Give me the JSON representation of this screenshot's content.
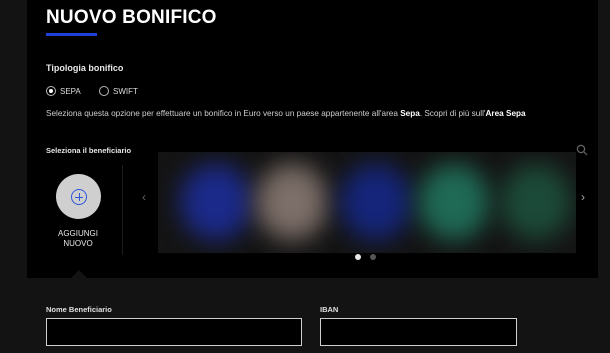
{
  "page": {
    "title": "NUOVO BONIFICO",
    "accent_color": "#1f3fd6"
  },
  "transfer_type": {
    "label": "Tipologia bonifico",
    "options": [
      {
        "label": "SEPA",
        "selected": true
      },
      {
        "label": "SWIFT",
        "selected": false
      }
    ],
    "description_prefix": "Seleziona questa opzione per effettuare un bonifico in Euro verso un paese appartenente all'area ",
    "description_bold": "Sepa",
    "description_middle": ". Scopri di più sull'",
    "description_link": "Area Sepa"
  },
  "beneficiary": {
    "label": "Seleziona il beneficiario",
    "search_icon": "search-icon",
    "add_label_line1": "AGGIUNGI",
    "add_label_line2": "NUOVO",
    "carousel_colors": [
      "#1b2a8a",
      "#7c6e68",
      "#15257a",
      "#1f6a55",
      "#1c4a38"
    ],
    "pagination": {
      "pages": 2,
      "active": 1
    }
  },
  "form": {
    "name_label": "Nome Beneficiario",
    "name_value": "",
    "iban_label": "IBAN",
    "iban_value": ""
  }
}
